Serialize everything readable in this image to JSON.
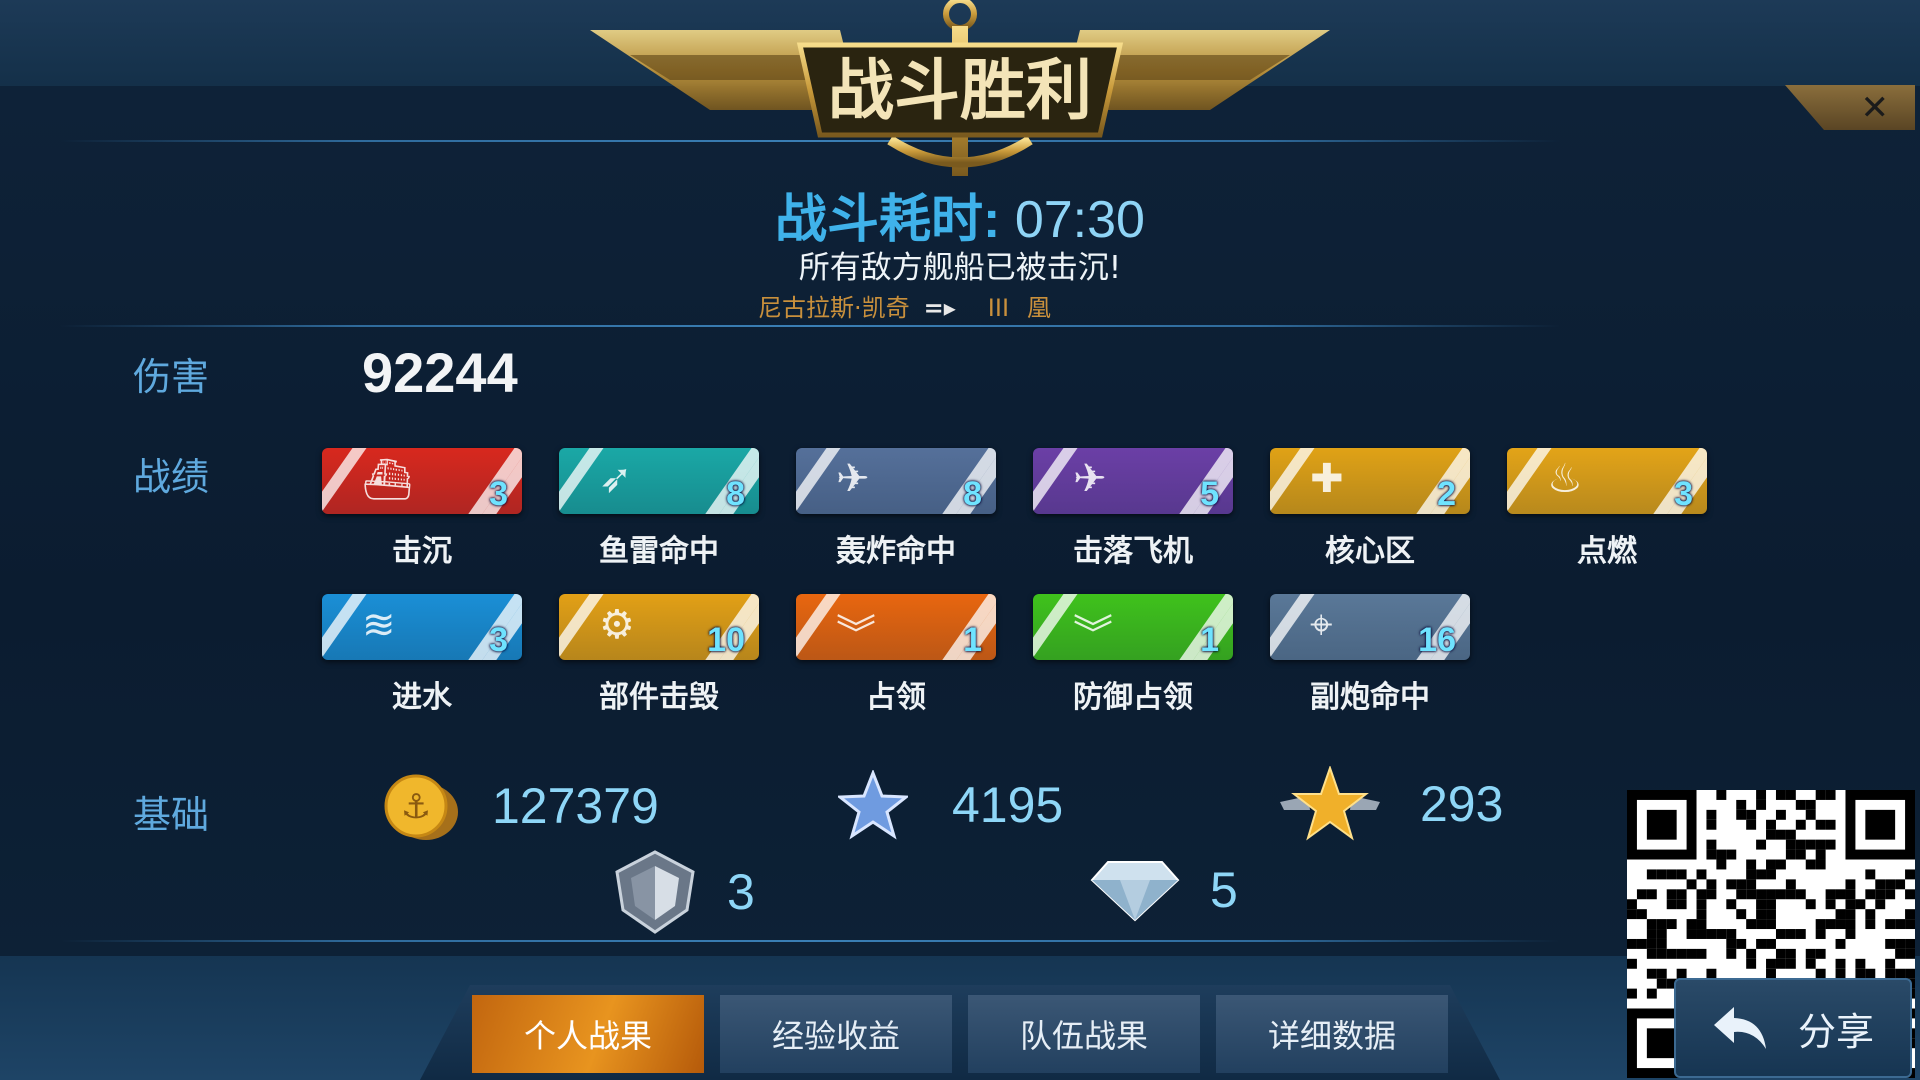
{
  "header": {
    "title": "战斗胜利",
    "close_symbol": "✕"
  },
  "battle": {
    "time_label": "战斗耗时:",
    "time_value": "07:30",
    "result_text": "所有敌方舰船已被击沉!",
    "captain": "尼古拉斯·凯奇",
    "arrow": "=▸",
    "tier": "III",
    "ship": "凰"
  },
  "sections": {
    "damage_label": "伤害",
    "achievements_label": "战绩",
    "base_label": "基础"
  },
  "damage": "92244",
  "achievements": [
    {
      "label": "击沉",
      "count": "3",
      "icon": "ship-icon",
      "color": "#d8281e"
    },
    {
      "label": "鱼雷命中",
      "count": "8",
      "icon": "torpedo-icon",
      "color": "#1aa8a6"
    },
    {
      "label": "轰炸命中",
      "count": "8",
      "icon": "bomber-icon",
      "color": "#55709a"
    },
    {
      "label": "击落飞机",
      "count": "5",
      "icon": "plane-down-icon",
      "color": "#6b3fa6"
    },
    {
      "label": "核心区",
      "count": "2",
      "icon": "citadel-icon",
      "color": "#e0a216"
    },
    {
      "label": "点燃",
      "count": "3",
      "icon": "fire-icon",
      "color": "#e3a418"
    },
    {
      "label": "进水",
      "count": "3",
      "icon": "flood-icon",
      "color": "#1a8fd6"
    },
    {
      "label": "部件击毁",
      "count": "10",
      "icon": "gear-icon",
      "color": "#e2a016"
    },
    {
      "label": "占领",
      "count": "1",
      "icon": "chevron-icon",
      "color": "#e8660f"
    },
    {
      "label": "防御占领",
      "count": "1",
      "icon": "defend-chevron-icon",
      "color": "#3fc21c"
    },
    {
      "label": "副炮命中",
      "count": "16",
      "icon": "secondary-gun-icon",
      "color": "#5a7898"
    }
  ],
  "resources": {
    "coins": "127379",
    "xp": "4195",
    "rank": "293",
    "shields": "3",
    "diamonds": "5"
  },
  "tabs": [
    "个人战果",
    "经验收益",
    "队伍战果",
    "详细数据"
  ],
  "share_label": "分享"
}
